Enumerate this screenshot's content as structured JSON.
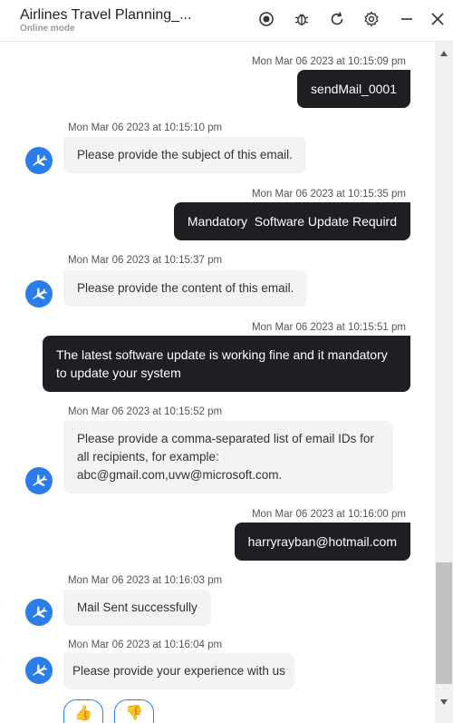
{
  "header": {
    "title": "Airlines Travel Planning_...",
    "status": "Online mode",
    "icons": [
      "record-icon",
      "bug-icon",
      "refresh-icon",
      "gear-icon",
      "minimize-icon",
      "close-icon"
    ]
  },
  "messages": [
    {
      "sender": "user",
      "timestamp": "Mon Mar 06 2023 at 10:15:09 pm",
      "text": "sendMail_0001"
    },
    {
      "sender": "bot",
      "timestamp": "Mon Mar 06 2023 at 10:15:10 pm",
      "text": "Please provide the subject of this email."
    },
    {
      "sender": "user",
      "timestamp": "Mon Mar 06 2023 at 10:15:35 pm",
      "text": "Mandatory  Software Update Requird"
    },
    {
      "sender": "bot",
      "timestamp": "Mon Mar 06 2023 at 10:15:37 pm",
      "text": "Please provide the content of this email."
    },
    {
      "sender": "user",
      "timestamp": "Mon Mar 06 2023 at 10:15:51 pm",
      "text": "The latest software update is working fine and it mandatory to update your system"
    },
    {
      "sender": "bot",
      "timestamp": "Mon Mar 06 2023 at 10:15:52 pm",
      "text": "Please provide a comma-separated list of email IDs for all recipients, for example: abc@gmail.com,uvw@microsoft.com."
    },
    {
      "sender": "user",
      "timestamp": "Mon Mar 06 2023 at 10:16:00 pm",
      "text": "harryrayban@hotmail.com"
    },
    {
      "sender": "bot",
      "timestamp": "Mon Mar 06 2023 at 10:16:03 pm",
      "text": "Mail Sent successfully"
    },
    {
      "sender": "bot",
      "timestamp": "Mon Mar 06 2023 at 10:16:04 pm",
      "text": "Please provide your experience with us"
    }
  ],
  "feedback": {
    "thumbs_up": "👍",
    "thumbs_down": "👎"
  },
  "colors": {
    "user_bubble": "#1e1f23",
    "bot_bubble": "#f2f3f5",
    "avatar": "#2b7de9"
  }
}
